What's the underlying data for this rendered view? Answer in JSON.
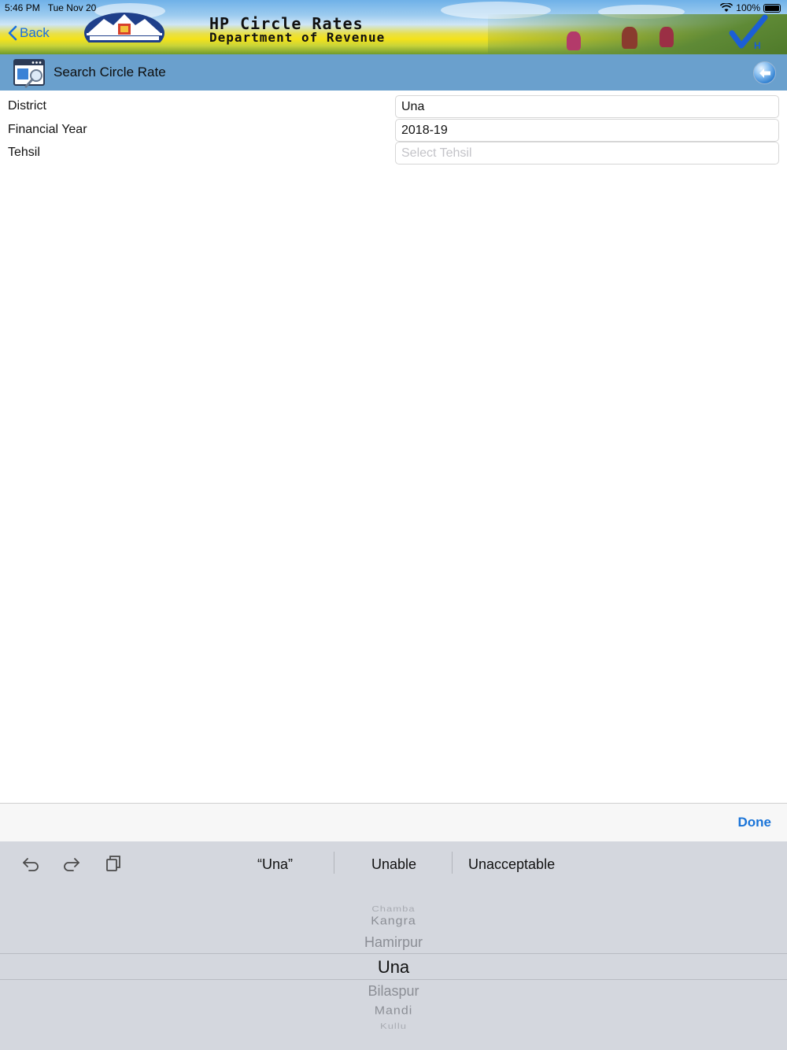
{
  "status_bar": {
    "time": "5:46 PM",
    "date": "Tue Nov 20",
    "battery": "100%"
  },
  "header": {
    "back_label": "Back",
    "title_line1": "HP Circle Rates",
    "title_line2": "Department of Revenue"
  },
  "titlebar": {
    "title": "Search Circle Rate"
  },
  "form": {
    "district_label": "District",
    "district_value": "Una",
    "year_label": "Financial Year",
    "year_value": "2018-19",
    "tehsil_label": "Tehsil",
    "tehsil_placeholder": "Select Tehsil"
  },
  "accessory": {
    "done_label": "Done"
  },
  "keyboard": {
    "suggestions": [
      "“Una”",
      "Unable",
      "Unacceptable"
    ],
    "icons": [
      "undo-icon",
      "redo-icon",
      "paste-icon"
    ]
  },
  "picker": {
    "options_above": [
      "Chamba",
      "Kangra",
      "Hamirpur"
    ],
    "selected": "Una",
    "options_below": [
      "Bilaspur",
      "Mandi",
      "Kullu"
    ]
  }
}
